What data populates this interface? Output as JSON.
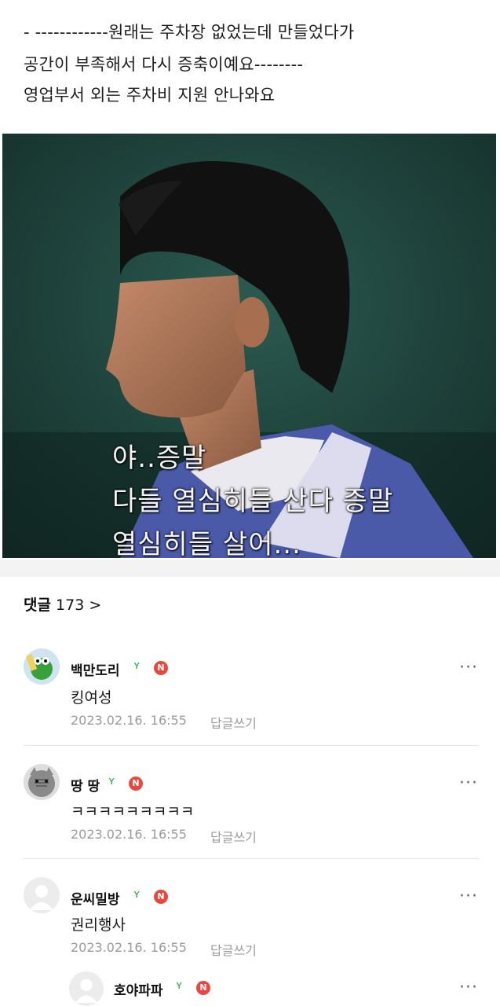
{
  "post": {
    "lines": [
      "- ------------원래는 주차장 없었는데 만들었다가",
      "공간이 부족해서 다시 증축이예요--------",
      "영업부서 외는 주차비 지원 안나와요"
    ],
    "image": {
      "caption_lines": [
        "야..증말",
        "다들 열심히들 산다 증말",
        "열심히들 살어..."
      ]
    }
  },
  "comments_section": {
    "label": "댓글",
    "count": "173",
    "chevron": ">"
  },
  "comments": [
    {
      "username": "백만도리",
      "badge": "N",
      "text": "킹여성",
      "date": "2023.02.16. 16:55",
      "reply": "답글쓰기",
      "avatar_icon": "frog-avatar-icon"
    },
    {
      "username": "땅 땅",
      "badge": "N",
      "text": "ㅋㅋㅋㅋㅋㅋㅋㅋㅋ",
      "date": "2023.02.16. 16:55",
      "reply": "답글쓰기",
      "avatar_icon": "cat-avatar-icon"
    },
    {
      "username": "운씨밀방",
      "badge": "N",
      "text": "권리행사",
      "date": "2023.02.16. 16:55",
      "reply": "답글쓰기",
      "avatar_icon": "default-avatar-icon"
    },
    {
      "username": "호야파파",
      "badge": "N",
      "avatar_icon": "default-avatar-icon"
    }
  ],
  "icons": {
    "more": "more-icon",
    "level": "sprout-icon",
    "badge": "n-badge-icon"
  },
  "colors": {
    "badge": "#e8493f",
    "sprout": "#27b24a",
    "meta": "#9b9b9b"
  }
}
